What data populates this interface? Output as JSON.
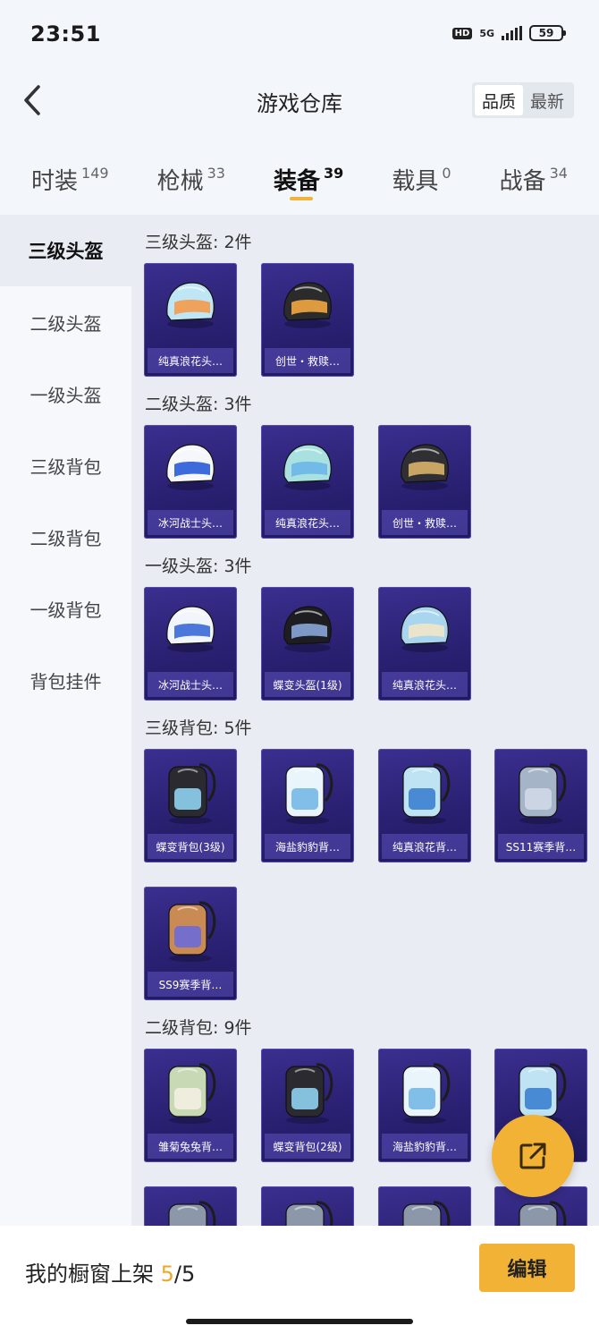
{
  "status": {
    "time": "23:51",
    "hd": "HD",
    "network": "5G",
    "battery": "59"
  },
  "nav": {
    "title": "游戏仓库",
    "sort_quality": "品质",
    "sort_latest": "最新"
  },
  "tabs": [
    {
      "label": "时装",
      "count": "149"
    },
    {
      "label": "枪械",
      "count": "33"
    },
    {
      "label": "装备",
      "count": "39"
    },
    {
      "label": "载具",
      "count": "0"
    },
    {
      "label": "战备",
      "count": "34"
    }
  ],
  "sidebar": [
    "三级头盔",
    "二级头盔",
    "一级头盔",
    "三级背包",
    "二级背包",
    "一级背包",
    "背包挂件"
  ],
  "groups": [
    {
      "title": "三级头盔: 2件",
      "items": [
        {
          "name": "纯真浪花头…",
          "icon": "ice-cream-helmet-icon"
        },
        {
          "name": "创世・救赎…",
          "icon": "visor-helmet-icon"
        }
      ]
    },
    {
      "title": "二级头盔: 3件",
      "items": [
        {
          "name": "冰河战士头…",
          "icon": "blue-helmet-icon"
        },
        {
          "name": "纯真浪花头…",
          "icon": "teal-helmet-icon"
        },
        {
          "name": "创世・救赎…",
          "icon": "dark-helmet-icon"
        }
      ]
    },
    {
      "title": "一级头盔: 3件",
      "items": [
        {
          "name": "冰河战士头…",
          "icon": "open-face-helmet-icon"
        },
        {
          "name": "蝶变头盔(1级)",
          "icon": "black-helmet-icon"
        },
        {
          "name": "纯真浪花头…",
          "icon": "light-blue-helmet-icon"
        }
      ]
    },
    {
      "title": "三级背包: 5件",
      "items": [
        {
          "name": "蝶变背包(3级)",
          "icon": "butterfly-backpack-icon"
        },
        {
          "name": "海盐豹豹背…",
          "icon": "seal-backpack-icon"
        },
        {
          "name": "纯真浪花背…",
          "icon": "drink-backpack-icon"
        },
        {
          "name": "SS11赛季背…",
          "icon": "grey-backpack-icon"
        },
        {
          "name": "SS9赛季背…",
          "icon": "tan-backpack-icon"
        }
      ]
    },
    {
      "title": "二级背包: 9件",
      "items": [
        {
          "name": "雏菊兔兔背…",
          "icon": "bunny-backpack-icon"
        },
        {
          "name": "蝶变背包(2级)",
          "icon": "butterfly-backpack-icon"
        },
        {
          "name": "海盐豹豹背…",
          "icon": "seal-backpack-icon"
        },
        {
          "name": "",
          "icon": "drink-backpack-icon"
        },
        {
          "name": "",
          "icon": "backpack-icon"
        },
        {
          "name": "",
          "icon": "backpack-icon"
        },
        {
          "name": "",
          "icon": "backpack-icon"
        },
        {
          "name": "",
          "icon": "backpack-icon"
        }
      ]
    }
  ],
  "bottom": {
    "label": "我的橱窗上架",
    "current": "5",
    "separator_total": "/5",
    "edit": "编辑"
  },
  "colors": {
    "accent": "#f1b236",
    "card": "#2a2173"
  }
}
